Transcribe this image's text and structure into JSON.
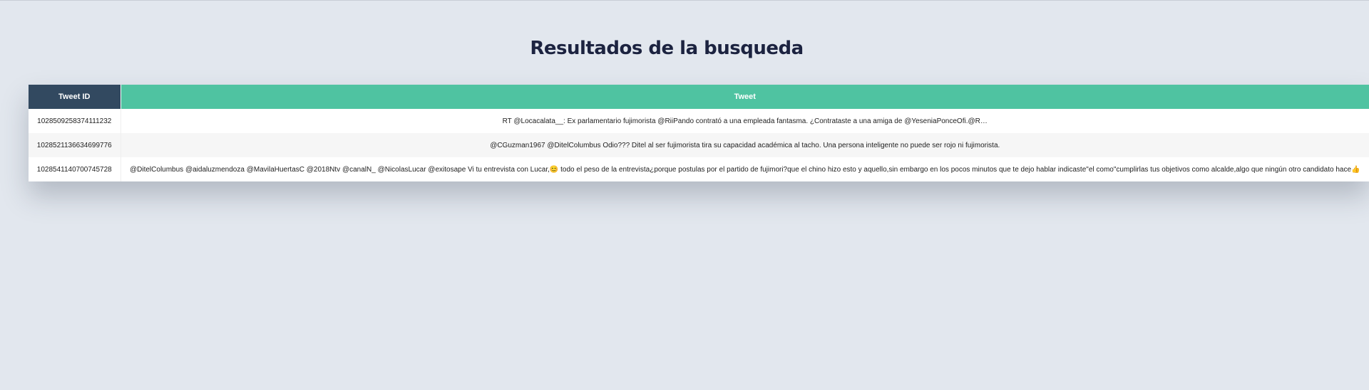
{
  "page": {
    "title": "Resultados de la busqueda"
  },
  "table": {
    "headers": {
      "id": "Tweet ID",
      "tweet": "Tweet"
    },
    "rows": [
      {
        "id": "1028509258374111232",
        "tweet": "RT @Locacalata__: Ex parlamentario fujimorista @RiiPando contrató a una empleada fantasma. ¿Contrataste a una amiga de @YeseniaPonceOfi.@R…"
      },
      {
        "id": "1028521136634699776",
        "tweet": "@CGuzman1967 @DitelColumbus Odio??? Ditel al ser fujimorista tira su capacidad académica al tacho. Una persona inteligente no puede ser rojo ni fujimorista."
      },
      {
        "id": "1028541140700745728",
        "tweet": "@DitelColumbus @aidaluzmendoza @MavilaHuertasC @2018Ntv @canalN_ @NicolasLucar @exitosape Vi tu entrevista con Lucar,😊 todo el peso de la entrevista¿porque postulas por el partido de fujimori?que el chino hizo esto y aquello,sin embargo en los pocos minutos que te dejo hablar indicaste\"el como\"cumplirlas tus objetivos como alcalde,algo que ningún otro candidato hace👍"
      }
    ]
  }
}
